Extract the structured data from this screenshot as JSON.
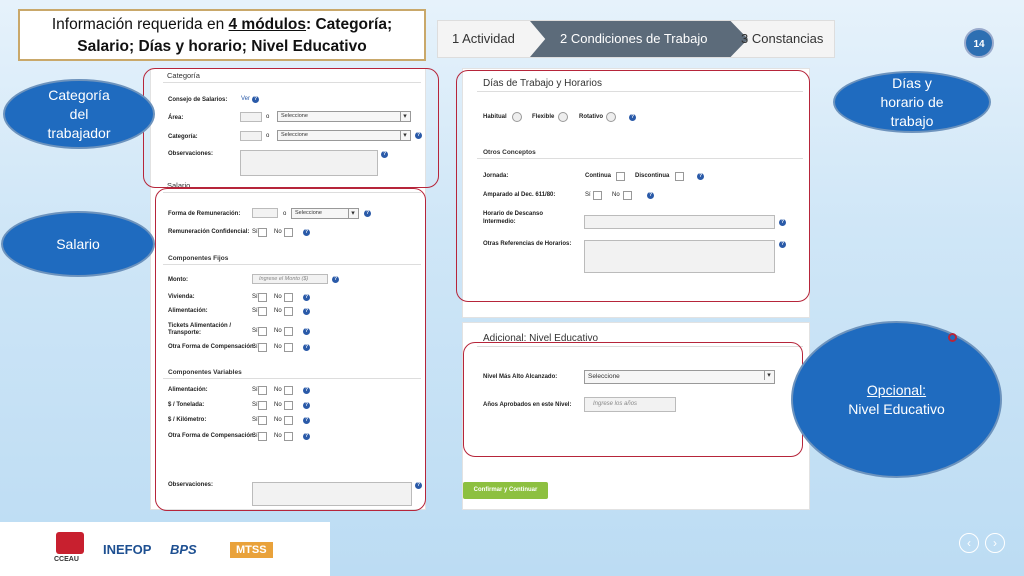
{
  "title": {
    "line1_a": "Información requerida en ",
    "line1_b": "4 módulos",
    "line1_c": ": Categoría;",
    "line2": "Salario; Días y horario; Nivel Educativo"
  },
  "wizard": {
    "steps": [
      {
        "label": "1 Actividad"
      },
      {
        "label": "2 Condiciones de Trabajo"
      },
      {
        "label": "3 Constancias"
      }
    ]
  },
  "page_number": "14",
  "categoria": {
    "title": "Categoría",
    "consejo_label": "Consejo de Salarios:",
    "ver_link": "Ver",
    "area_label": "Área:",
    "area_sep": "o",
    "area_select": "Seleccione",
    "categoria_label": "Categoría:",
    "categoria_sep": "o",
    "categoria_select": "Seleccione",
    "observaciones_label": "Observaciones:"
  },
  "salario": {
    "title": "Salario",
    "forma_label": "Forma de Remuneración:",
    "forma_sep": "o",
    "forma_select": "Seleccione",
    "remun_conf_label": "Remuneración Confidencial:",
    "componentes_fijos": "Componentes Fijos",
    "monto_label": "Monto:",
    "monto_placeholder": "Ingrese el Monto ($)",
    "vivienda_label": "Vivienda:",
    "alimentacion_label": "Alimentación:",
    "tickets_label": "Tickets Alimentación / Transporte:",
    "otra_forma_label": "Otra Forma de Compensación:",
    "componentes_variables": "Componentes Variables",
    "alimentacion_v_label": "Alimentación:",
    "tonelada_label": "$ / Tonelada:",
    "kilometro_label": "$ / Kilómetro:",
    "otra_forma_v_label": "Otra Forma de Compensación:",
    "observaciones_label": "Observaciones:",
    "si": "Sí",
    "no": "No"
  },
  "dias": {
    "title": "Días de Trabajo y Horarios",
    "habitual": "Habitual",
    "flexible": "Flexible",
    "rotativo": "Rotativo",
    "otros_conceptos": "Otros Conceptos",
    "jornada_label": "Jornada:",
    "continua": "Continua",
    "discontinua": "Discontinua",
    "amparado_label": "Amparado al Dec. 611/80:",
    "si": "Sí",
    "no": "No",
    "horario_descanso_label_1": "Horario de Descanso",
    "horario_descanso_label_2": "Intermedio:",
    "otras_ref_label": "Otras Referencias de Horarios:"
  },
  "adicional": {
    "title": "Adicional: Nivel Educativo",
    "nivel_label": "Nivel Más Alto Alcanzado:",
    "nivel_select": "Seleccione",
    "anios_label": "Años Aprobados en este Nivel:",
    "anios_placeholder": "Ingrese los años",
    "confirm_button": "Confirmar y Continuar"
  },
  "ovals": {
    "categoria": "Categoría del trabajador",
    "salario": "Salario",
    "dias": "Días y horario de trabajo",
    "opcional_title": "Opcional:",
    "opcional_sub": "Nivel Educativo"
  },
  "logos": {
    "cceau": "CCEAU",
    "inefop": "INEFOP",
    "bps": "BPS",
    "mtss": "MTSS"
  },
  "nav": {
    "prev": "‹",
    "next": "›"
  }
}
